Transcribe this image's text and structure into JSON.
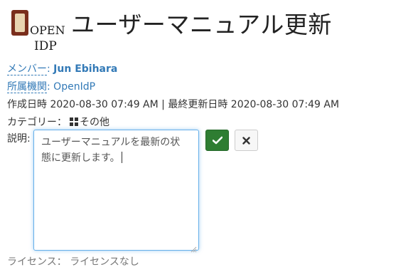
{
  "logo": {
    "line1": "OPEN",
    "line2": "IDP"
  },
  "page_title": "ユーザーマニュアル更新",
  "member": {
    "label": "メンバー",
    "colon": ":",
    "value": "Jun Ebihara"
  },
  "affiliation": {
    "label": "所属機関",
    "colon": ":",
    "value": "OpenIdP"
  },
  "dates": "作成日時 2020-08-30 07:49 AM | 最終更新日時 2020-08-30 07:49 AM",
  "category": {
    "label": "カテゴリー：",
    "value": "その他"
  },
  "description": {
    "label": "説明:",
    "line1": "ユーザーマニュアルを最新の状",
    "line2": "態に更新します。"
  },
  "license": {
    "label": "ライセンス：",
    "value": "ライセンスなし"
  },
  "colors": {
    "accent": "#337ab7",
    "ok_button": "#2e7d32",
    "focus_border": "#66afe9"
  },
  "icons": {
    "ok": "check-icon",
    "cancel": "close-icon",
    "category": "grid-icon"
  }
}
